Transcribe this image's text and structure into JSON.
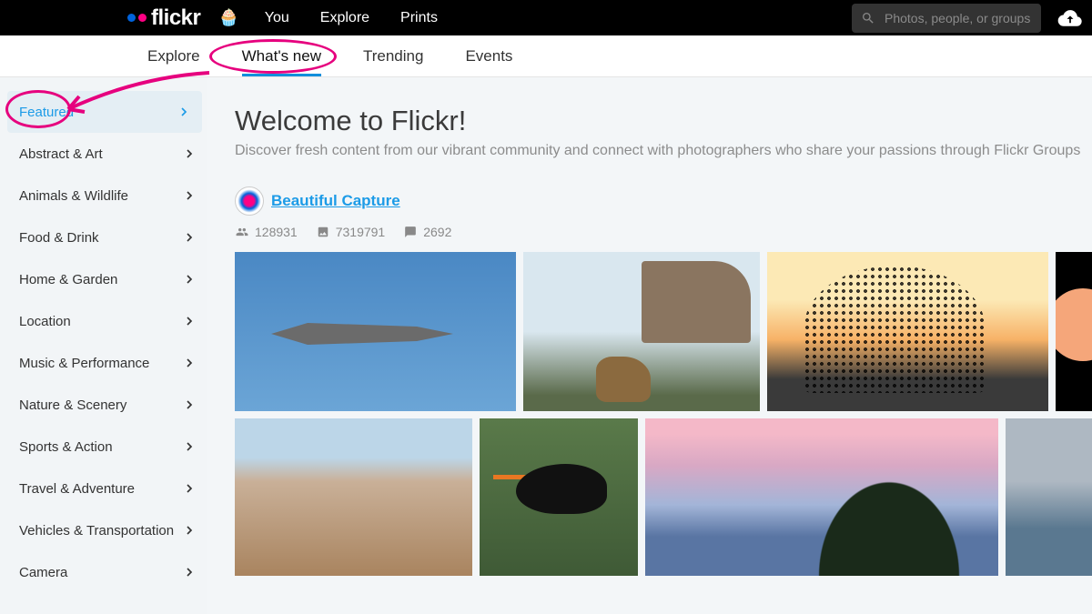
{
  "header": {
    "logo_text": "flickr",
    "nav": {
      "you": "You",
      "explore": "Explore",
      "prints": "Prints"
    },
    "search_placeholder": "Photos, people, or groups"
  },
  "subtabs": {
    "explore": "Explore",
    "whats_new": "What's new",
    "trending": "Trending",
    "events": "Events"
  },
  "sidebar": {
    "items": [
      {
        "label": "Featured"
      },
      {
        "label": "Abstract & Art"
      },
      {
        "label": "Animals & Wildlife"
      },
      {
        "label": "Food & Drink"
      },
      {
        "label": "Home & Garden"
      },
      {
        "label": "Location"
      },
      {
        "label": "Music & Performance"
      },
      {
        "label": "Nature & Scenery"
      },
      {
        "label": "Sports & Action"
      },
      {
        "label": "Travel & Adventure"
      },
      {
        "label": "Vehicles & Transportation"
      },
      {
        "label": "Camera"
      }
    ]
  },
  "main": {
    "welcome_title": "Welcome to Flickr!",
    "welcome_sub": "Discover fresh content from our vibrant community and connect with photographers who share your passions through Flickr Groups",
    "group": {
      "name": "Beautiful Capture",
      "members": "128931",
      "photos": "7319791",
      "discussions": "2692"
    }
  },
  "colors": {
    "accent": "#128fdc",
    "link": "#1c9be7",
    "annotation": "#e6007e"
  }
}
